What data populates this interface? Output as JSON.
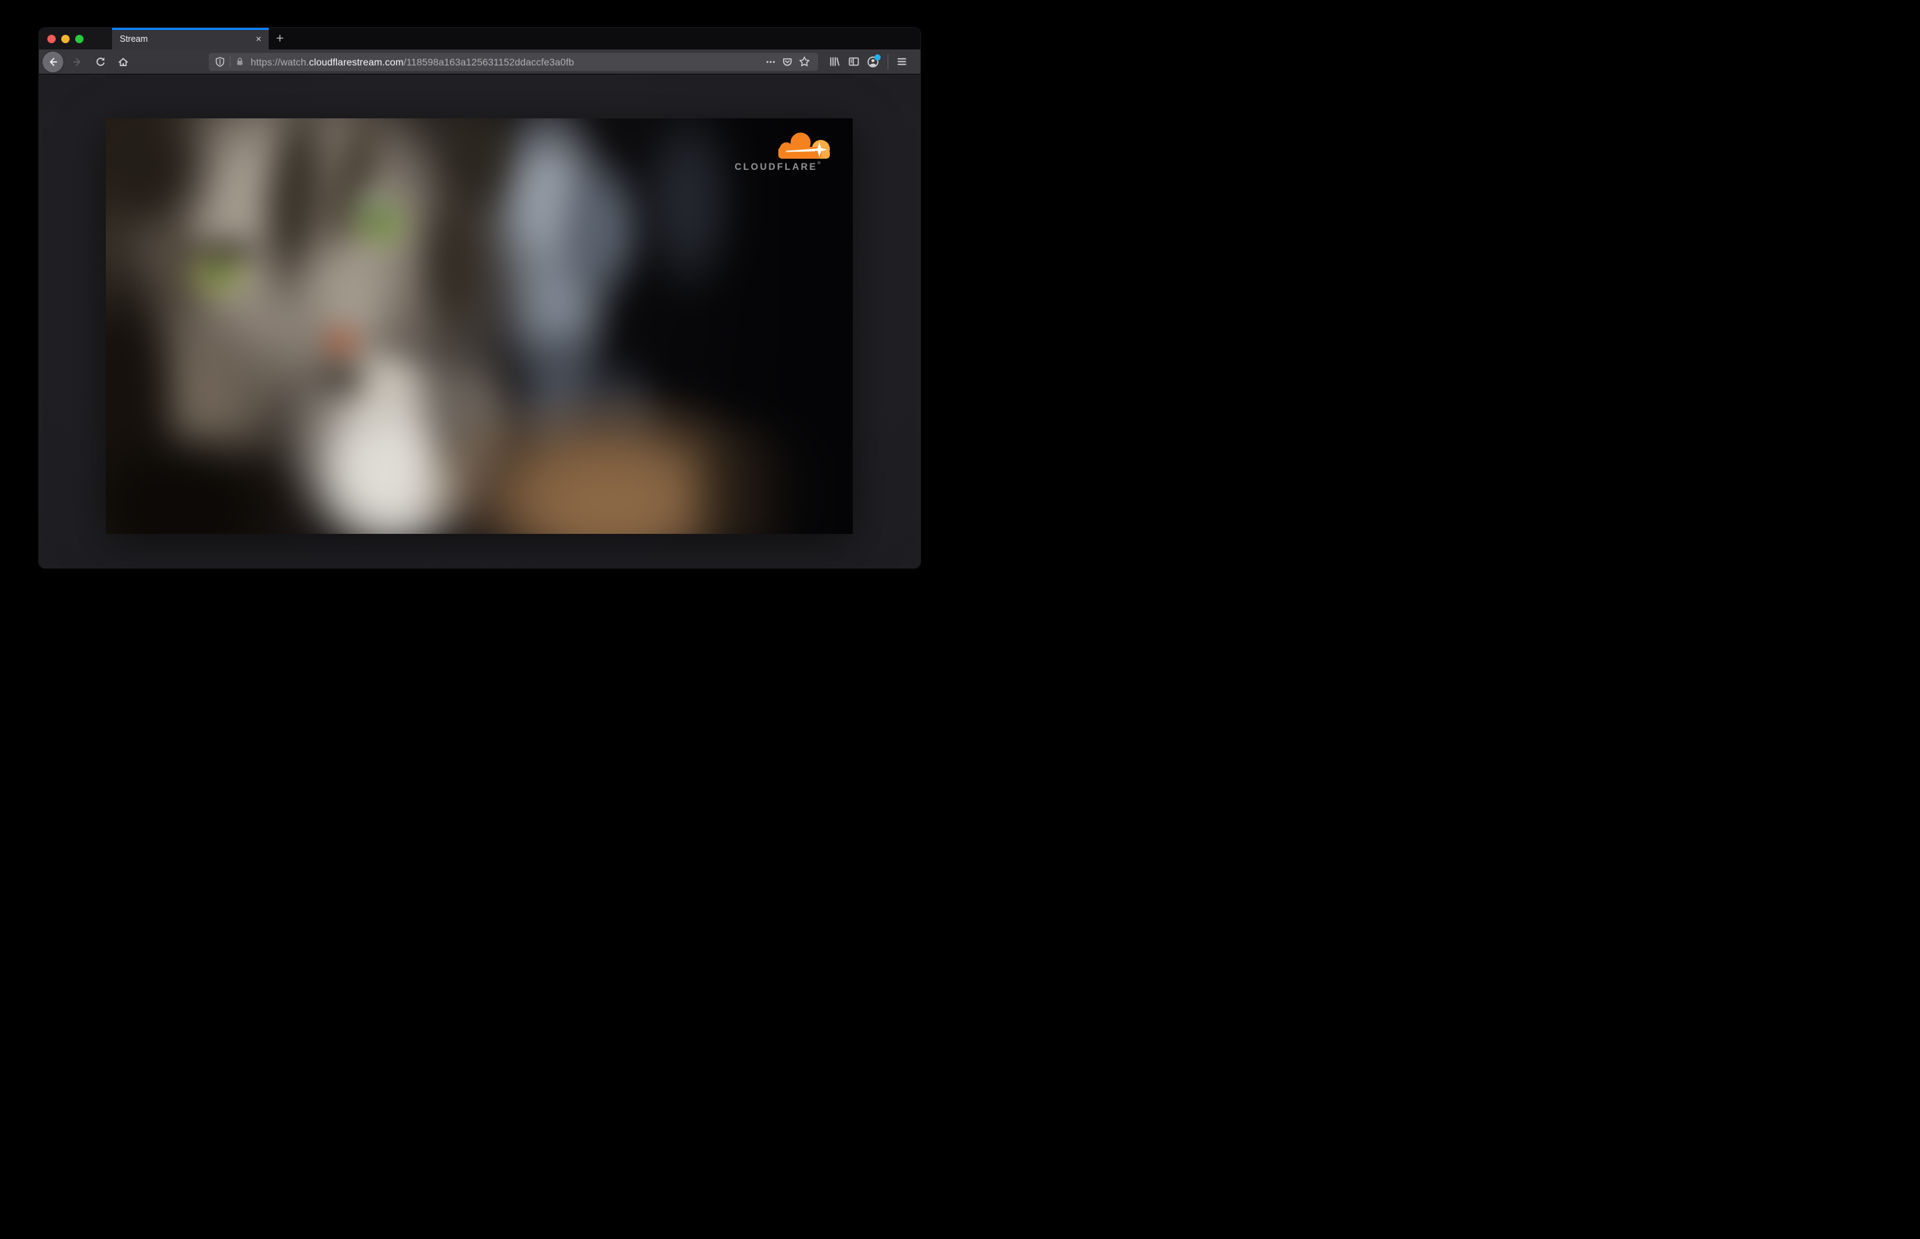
{
  "chrome": {
    "tab": {
      "title": "Stream",
      "close_glyph": "×"
    },
    "new_tab_glyph": "+",
    "url_bar": {
      "scheme_subdomain": "https://watch.",
      "domain": "cloudflarestream.com",
      "path": "/118598a163a125631152ddaccfe3a0fb"
    }
  },
  "video": {
    "brand": {
      "name": "CLOUDFLARE",
      "reg_mark": "®"
    }
  },
  "colors": {
    "accent_blue": "#0a84ff",
    "badge_blue": "#1fb2f0",
    "cloudflare_orange": "#f6821f",
    "cloudflare_light_orange": "#fbad41",
    "traffic_red": "#f25c57",
    "traffic_yellow": "#f5b52e",
    "traffic_green": "#2ac93f"
  }
}
